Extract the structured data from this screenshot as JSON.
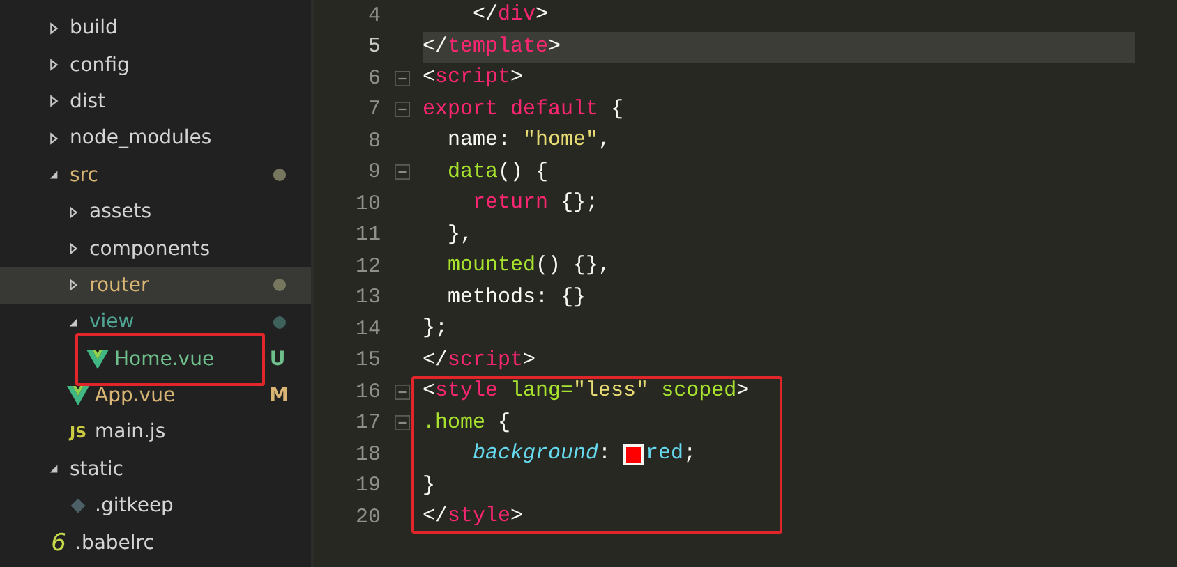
{
  "sidebar": {
    "tree": [
      {
        "name": "build",
        "kind": "folder",
        "expanded": false,
        "selected": false,
        "color": "#d4d4d4"
      },
      {
        "name": "config",
        "kind": "folder",
        "expanded": false,
        "selected": false,
        "color": "#d4d4d4"
      },
      {
        "name": "dist",
        "kind": "folder",
        "expanded": false,
        "selected": false,
        "color": "#d4d4d4"
      },
      {
        "name": "node_modules",
        "kind": "folder",
        "expanded": false,
        "selected": false,
        "color": "#d4d4d4"
      },
      {
        "name": "src",
        "kind": "folder",
        "expanded": true,
        "selected": false,
        "color": "#d9b574",
        "dot": {
          "color": "#77775f"
        },
        "children": [
          {
            "name": "assets",
            "kind": "folder",
            "expanded": false,
            "selected": false,
            "color": "#d4d4d4"
          },
          {
            "name": "components",
            "kind": "folder",
            "expanded": false,
            "selected": false,
            "color": "#d4d4d4"
          },
          {
            "name": "router",
            "kind": "folder",
            "expanded": false,
            "selected": true,
            "color": "#d9b574",
            "dot": {
              "color": "#77775f"
            }
          },
          {
            "name": "view",
            "kind": "folder",
            "expanded": true,
            "selected": false,
            "color": "#4fa593",
            "dot": {
              "color": "#3f615b"
            },
            "children": [
              {
                "name": "Home.vue",
                "kind": "vue",
                "selected": false,
                "color": "#6fbf8c",
                "badge": "U",
                "highlighted": true
              }
            ]
          },
          {
            "name": "App.vue",
            "kind": "vue",
            "selected": false,
            "color": "#d9b574",
            "badge": "M"
          },
          {
            "name": "main.js",
            "kind": "js",
            "icon_label": "JS",
            "selected": false,
            "color": "#d4d4d4"
          }
        ]
      },
      {
        "name": "static",
        "kind": "folder",
        "expanded": true,
        "selected": false,
        "color": "#d4d4d4",
        "children": [
          {
            "name": ".gitkeep",
            "kind": "gitkeep",
            "selected": false,
            "color": "#d4d4d4"
          }
        ]
      },
      {
        "name": ".babelrc",
        "kind": "babel",
        "icon_label": "6",
        "selected": false,
        "color": "#d4d4d4"
      }
    ]
  },
  "editor": {
    "lines": [
      {
        "number": "4",
        "fold": false,
        "current": false,
        "boxed": false,
        "tokens": [
          {
            "text": "    </",
            "kind": "punct"
          },
          {
            "text": "div",
            "kind": "tag"
          },
          {
            "text": ">",
            "kind": "punct"
          }
        ]
      },
      {
        "number": "5",
        "fold": false,
        "current": true,
        "boxed": false,
        "tokens": [
          {
            "text": "</",
            "kind": "punct"
          },
          {
            "text": "template",
            "kind": "tag"
          },
          {
            "text": ">",
            "kind": "punct"
          }
        ]
      },
      {
        "number": "6",
        "fold": true,
        "current": false,
        "boxed": false,
        "tokens": [
          {
            "text": "<",
            "kind": "punct"
          },
          {
            "text": "script",
            "kind": "tag"
          },
          {
            "text": ">",
            "kind": "punct"
          }
        ]
      },
      {
        "number": "7",
        "fold": true,
        "current": false,
        "boxed": false,
        "tokens": [
          {
            "text": "export default",
            "kind": "keyword"
          },
          {
            "text": " {",
            "kind": "punct"
          }
        ]
      },
      {
        "number": "8",
        "fold": false,
        "current": false,
        "boxed": false,
        "tokens": [
          {
            "text": "  name: ",
            "kind": "punct"
          },
          {
            "text": "\"home\"",
            "kind": "string"
          },
          {
            "text": ",",
            "kind": "punct"
          }
        ]
      },
      {
        "number": "9",
        "fold": true,
        "current": false,
        "boxed": false,
        "tokens": [
          {
            "text": "  data",
            "kind": "func"
          },
          {
            "text": "() {",
            "kind": "punct"
          }
        ]
      },
      {
        "number": "10",
        "fold": false,
        "current": false,
        "boxed": false,
        "tokens": [
          {
            "text": "    return",
            "kind": "keyword"
          },
          {
            "text": " {};",
            "kind": "punct"
          }
        ]
      },
      {
        "number": "11",
        "fold": false,
        "current": false,
        "boxed": false,
        "tokens": [
          {
            "text": "  },",
            "kind": "punct"
          }
        ]
      },
      {
        "number": "12",
        "fold": false,
        "current": false,
        "boxed": false,
        "tokens": [
          {
            "text": "  mounted",
            "kind": "func"
          },
          {
            "text": "() {},",
            "kind": "punct"
          }
        ]
      },
      {
        "number": "13",
        "fold": false,
        "current": false,
        "boxed": false,
        "tokens": [
          {
            "text": "  methods: {}",
            "kind": "punct"
          }
        ]
      },
      {
        "number": "14",
        "fold": false,
        "current": false,
        "boxed": false,
        "tokens": [
          {
            "text": "};",
            "kind": "punct"
          }
        ]
      },
      {
        "number": "15",
        "fold": false,
        "current": false,
        "boxed": false,
        "tokens": [
          {
            "text": "</",
            "kind": "punct"
          },
          {
            "text": "script",
            "kind": "tag"
          },
          {
            "text": ">",
            "kind": "punct"
          }
        ]
      },
      {
        "number": "16",
        "fold": true,
        "current": false,
        "boxed": true,
        "tokens": [
          {
            "text": "<",
            "kind": "punct"
          },
          {
            "text": "style",
            "kind": "tag"
          },
          {
            "text": " lang=",
            "kind": "attr"
          },
          {
            "text": "\"less\"",
            "kind": "string"
          },
          {
            "text": " scoped",
            "kind": "attr"
          },
          {
            "text": ">",
            "kind": "punct"
          }
        ]
      },
      {
        "number": "17",
        "fold": true,
        "current": false,
        "boxed": true,
        "tokens": [
          {
            "text": ".home",
            "kind": "func"
          },
          {
            "text": " {",
            "kind": "punct"
          }
        ]
      },
      {
        "number": "18",
        "fold": false,
        "current": false,
        "boxed": true,
        "tokens": [
          {
            "text": "    background",
            "kind": "property"
          },
          {
            "text": ": ",
            "kind": "punct"
          },
          {
            "kind": "swatch",
            "color": "#ff0000"
          },
          {
            "text": "red",
            "kind": "value"
          },
          {
            "text": ";",
            "kind": "punct"
          }
        ]
      },
      {
        "number": "19",
        "fold": false,
        "current": false,
        "boxed": true,
        "tokens": [
          {
            "text": "}",
            "kind": "punct"
          }
        ]
      },
      {
        "number": "20",
        "fold": false,
        "current": false,
        "boxed": true,
        "tokens": [
          {
            "text": "</",
            "kind": "punct"
          },
          {
            "text": "style",
            "kind": "tag"
          },
          {
            "text": ">",
            "kind": "punct"
          }
        ]
      }
    ]
  }
}
